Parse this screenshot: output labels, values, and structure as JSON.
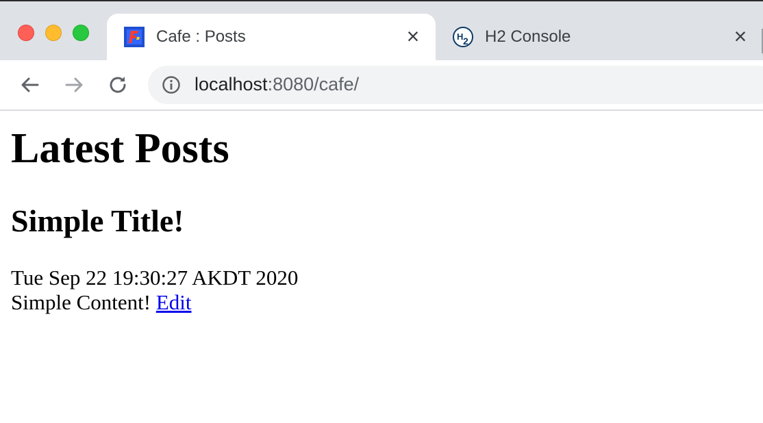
{
  "browser": {
    "tabs": [
      {
        "title": "Cafe : Posts",
        "active": true,
        "favicon": "cafe-favicon"
      },
      {
        "title": "H2 Console",
        "active": false,
        "favicon": "h2-favicon"
      }
    ],
    "address": {
      "host": "localhost",
      "rest": ":8080/cafe/"
    }
  },
  "page": {
    "heading": "Latest Posts",
    "post": {
      "title": "Simple Title!",
      "date": "Tue Sep 22 19:30:27 AKDT 2020",
      "content": "Simple Content!",
      "edit_label": "Edit"
    }
  },
  "colors": {
    "link": "#0000ee",
    "tab_strip": "#dee1e6",
    "omnibox": "#f1f3f4"
  }
}
